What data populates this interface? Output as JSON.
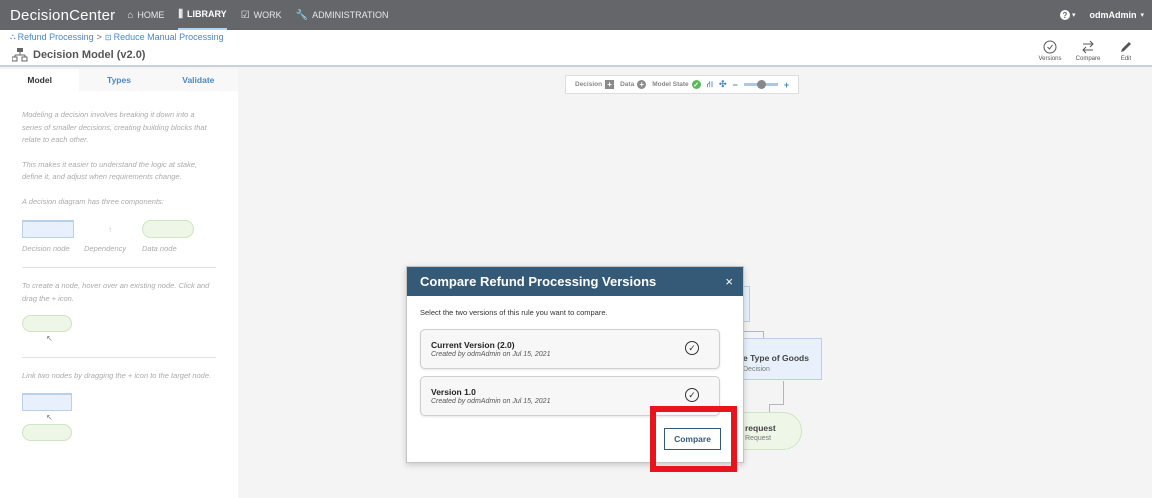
{
  "topnav": {
    "brand": "DecisionCenter",
    "items": [
      {
        "label": "HOME",
        "icon": "home-icon"
      },
      {
        "label": "LIBRARY",
        "icon": "library-icon"
      },
      {
        "label": "WORK",
        "icon": "work-icon"
      },
      {
        "label": "ADMINISTRATION",
        "icon": "wrench-icon"
      }
    ],
    "user": "odmAdmin"
  },
  "breadcrumb": {
    "item1": "Refund Processing",
    "separator": ">",
    "item2": "Reduce Manual Processing"
  },
  "page_title": "Decision Model (v2.0)",
  "toolbar": {
    "versions": "Versions",
    "compare": "Compare",
    "edit": "Edit"
  },
  "left_tabs": [
    "Model",
    "Types",
    "Validate"
  ],
  "left_panel": {
    "p1": "Modeling a decision involves breaking it down into a series of smaller decisions, creating building blocks that relate to each other.",
    "p2": "This makes it easier to understand the logic at stake, define it, and adjust when requirements change.",
    "p3": "A decision diagram has three components:",
    "legend": {
      "decision_node": "Decision node",
      "dependency": "Dependency",
      "data_node": "Data node"
    },
    "p4": "To create a node, hover over an existing node. Click and drag the + icon.",
    "p5": "Link two nodes by dragging the + icon to the target node."
  },
  "canvas_toolbar": {
    "decision": "Decision",
    "data": "Data",
    "model_state": "Model State"
  },
  "background_nodes": {
    "node1_title": "e Type of Goods",
    "node1_sub": "Decision",
    "node2_title": "request",
    "node2_sub": "Request"
  },
  "modal": {
    "title": "Compare Refund Processing Versions",
    "close": "×",
    "instruction": "Select the two versions of this rule you want to compare.",
    "versions": [
      {
        "title": "Current Version (2.0)",
        "sub": "Created by odmAdmin on Jul 15, 2021"
      },
      {
        "title": "Version 1.0",
        "sub": "Created by odmAdmin on Jul 15, 2021"
      }
    ],
    "compare_button": "Compare"
  },
  "colors": {
    "nav_bg": "#646669",
    "modal_header": "#345a78",
    "accent_blue": "#4a88c6",
    "highlight": "#e8141c"
  }
}
